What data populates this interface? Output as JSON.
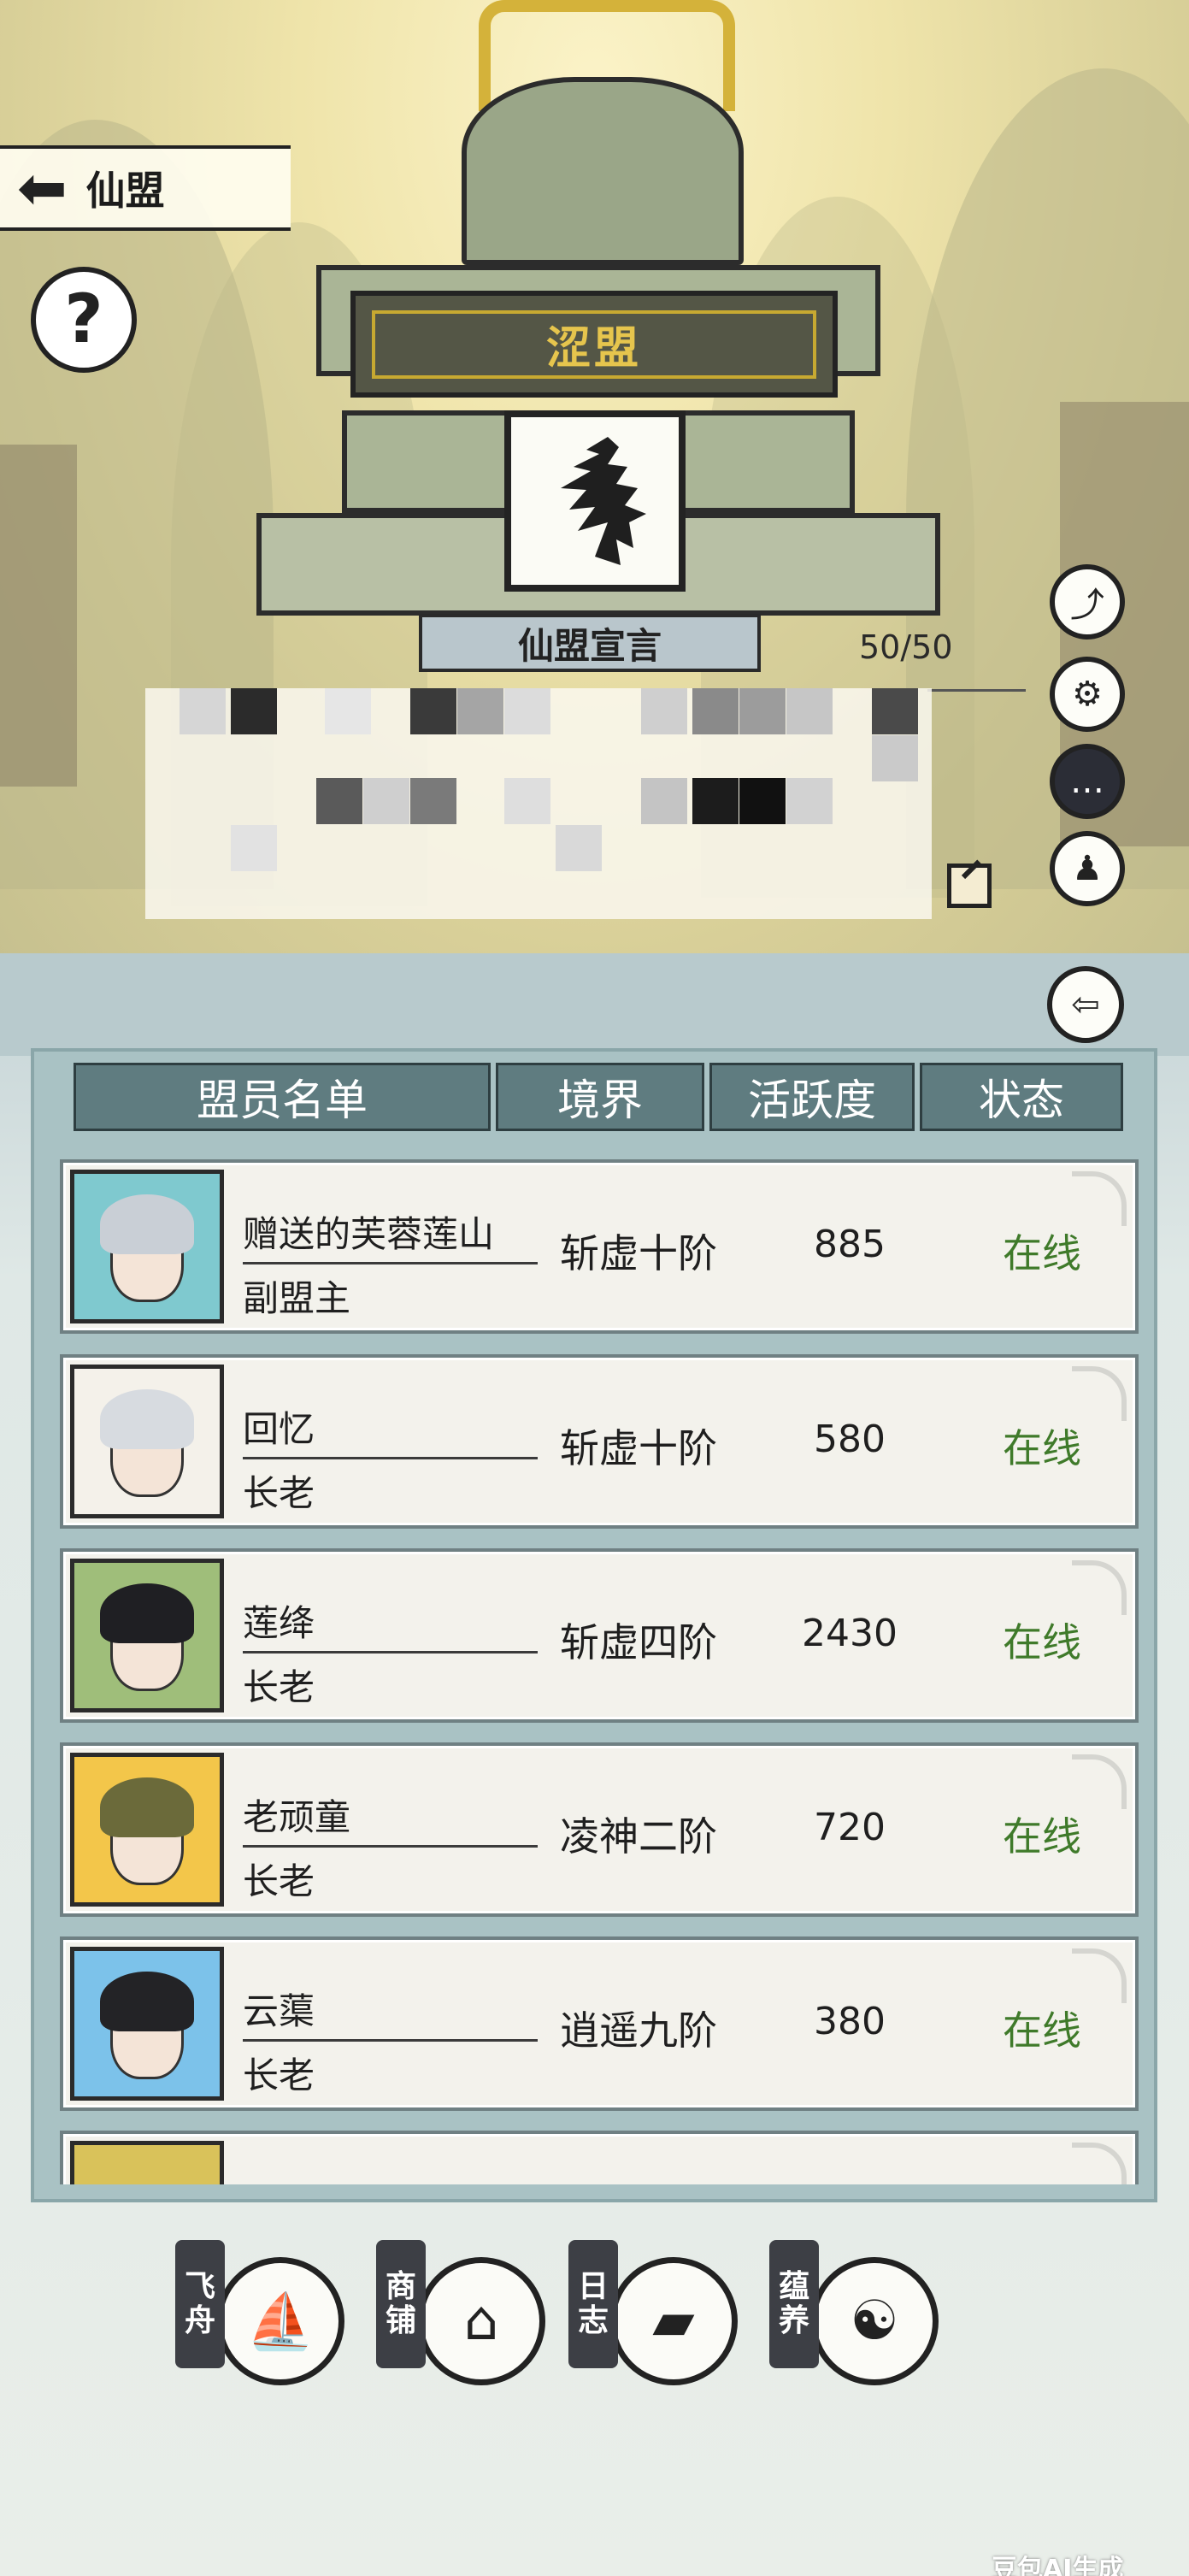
{
  "header": {
    "back_label": "仙盟",
    "help_label": "?"
  },
  "guild": {
    "name": "涩盟",
    "emblem_glyph": "龙",
    "motto_title": "仙盟宣言",
    "member_count": "50/50"
  },
  "side_buttons": [
    {
      "icon": "share-icon",
      "glyph": "⤴"
    },
    {
      "icon": "gear-icon",
      "glyph": "⚙"
    },
    {
      "icon": "chat-icon",
      "glyph": "…"
    },
    {
      "icon": "add-member-icon",
      "glyph": "♟"
    }
  ],
  "member_table": {
    "columns": [
      "盟员名单",
      "境界",
      "活跃度",
      "状态"
    ],
    "rows": [
      {
        "name": "赠送的芙蓉莲山",
        "role": "副盟主",
        "realm": "斩虚十阶",
        "activity": "885",
        "status": "在线",
        "frame_color": "#7fc9cf",
        "hair_color": "#c9cfd6"
      },
      {
        "name": "回忆",
        "role": "长老",
        "realm": "斩虚十阶",
        "activity": "580",
        "status": "在线",
        "frame_color": "#f4f1ea",
        "hair_color": "#d7dbe0"
      },
      {
        "name": "莲绛",
        "role": "长老",
        "realm": "斩虚四阶",
        "activity": "2430",
        "status": "在线",
        "frame_color": "#9fbe7a",
        "hair_color": "#1f1f23"
      },
      {
        "name": "老顽童",
        "role": "长老",
        "realm": "凌神二阶",
        "activity": "720",
        "status": "在线",
        "frame_color": "#f3c64a",
        "hair_color": "#6b6a3a"
      },
      {
        "name": "云蕖",
        "role": "长老",
        "realm": "逍遥九阶",
        "activity": "380",
        "status": "在线",
        "frame_color": "#7cc2ea",
        "hair_color": "#232326"
      }
    ]
  },
  "bottom_nav": [
    {
      "label": "飞舟",
      "icon": "airship-icon",
      "glyph": "⛵"
    },
    {
      "label": "商铺",
      "icon": "shop-icon",
      "glyph": "⌂"
    },
    {
      "label": "日志",
      "icon": "log-book-icon",
      "glyph": "▰"
    },
    {
      "label": "蕴养",
      "icon": "yin-yang-icon",
      "glyph": "☯"
    }
  ],
  "watermark": "豆包AI生成",
  "colors": {
    "online": "#3f7a2a",
    "header_cell": "#5f7c80",
    "guild_name": "#e6c54d"
  }
}
